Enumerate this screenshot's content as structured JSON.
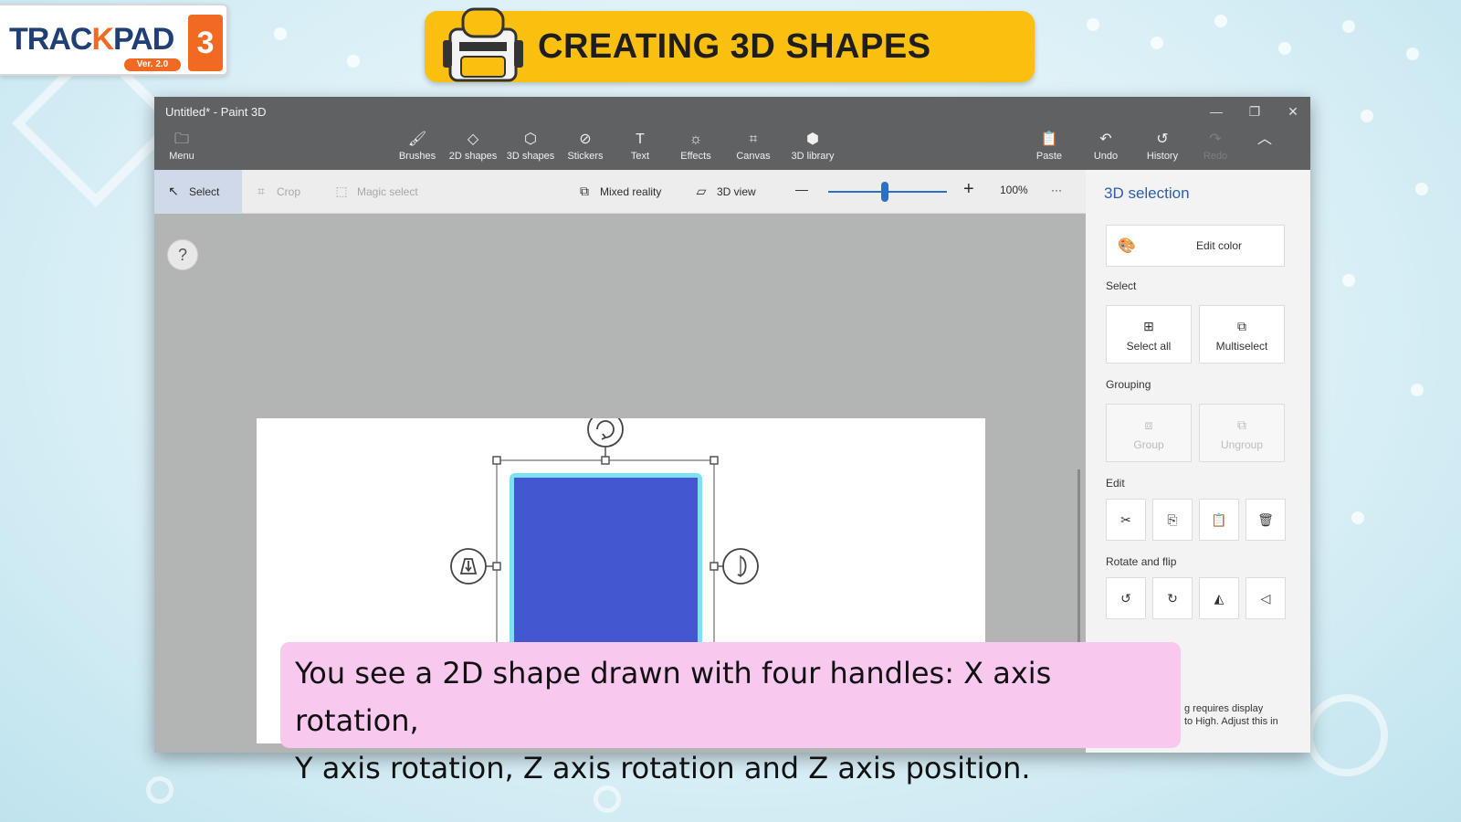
{
  "logo": {
    "brand_a": "TRAC",
    "brand_b": "K",
    "brand_c": "PAD",
    "number": "3",
    "version": "Ver. 2.0"
  },
  "banner": {
    "title": "CREATING 3D SHAPES"
  },
  "window": {
    "title": "Untitled* - Paint 3D",
    "controls": {
      "minimize": "—",
      "restore": "❐",
      "close": "✕"
    }
  },
  "ribbon": {
    "menu": "Menu",
    "tools": [
      {
        "label": "Brushes",
        "icon": "brush-icon"
      },
      {
        "label": "2D shapes",
        "icon": "2d-shapes-icon"
      },
      {
        "label": "3D shapes",
        "icon": "3d-shapes-icon"
      },
      {
        "label": "Stickers",
        "icon": "stickers-icon"
      },
      {
        "label": "Text",
        "icon": "text-icon"
      },
      {
        "label": "Effects",
        "icon": "effects-icon"
      },
      {
        "label": "Canvas",
        "icon": "canvas-icon"
      },
      {
        "label": "3D library",
        "icon": "3d-library-icon"
      }
    ],
    "paste": "Paste",
    "undo": "Undo",
    "history": "History",
    "redo": "Redo"
  },
  "toolbar": {
    "select": "Select",
    "crop": "Crop",
    "magic_select": "Magic select",
    "mixed_reality": "Mixed reality",
    "view_3d": "3D view",
    "zoom_minus": "—",
    "zoom_plus": "+",
    "zoom_level": "100%",
    "more": "···",
    "zoom_fraction": 0.48
  },
  "workspace": {
    "help": "?"
  },
  "shape": {
    "fill_color": "#4357d0",
    "glow_color": "#7ee0f4"
  },
  "panel": {
    "title": "3D selection",
    "edit_color": "Edit color",
    "select_heading": "Select",
    "select_all": "Select all",
    "multiselect": "Multiselect",
    "grouping_heading": "Grouping",
    "group": "Group",
    "ungroup": "Ungroup",
    "edit_heading": "Edit",
    "rotate_heading": "Rotate and flip",
    "note_line1": "g requires display",
    "note_line2": "to High. Adjust this in"
  },
  "subtitle": {
    "line1": "You see a 2D shape drawn with four handles: X axis rotation,",
    "line2": "Y axis rotation, Z axis rotation and Z axis position."
  },
  "colors": {
    "accent": "#2d5fa8",
    "banner": "#fbbf10",
    "subtitle_bg": "#f9c8ef",
    "chrome": "#5f6163"
  }
}
